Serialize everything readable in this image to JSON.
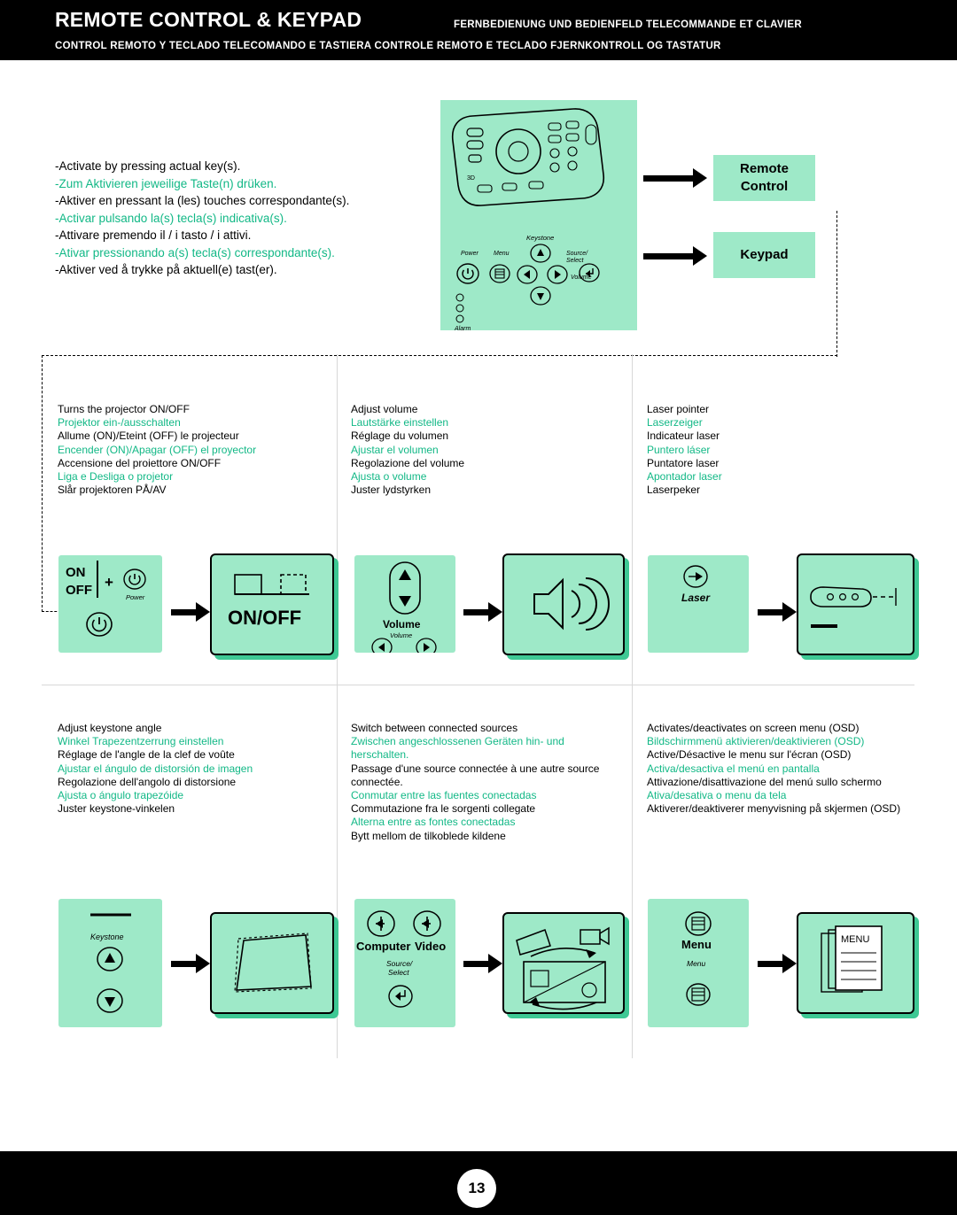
{
  "header": {
    "title": "REMOTE CONTROL & KEYPAD",
    "sub_right": "FERNBEDIENUNG UND BEDIENFELD   TELECOMMANDE ET CLAVIER",
    "sub_bottom": "CONTROL REMOTO Y TECLADO   TELECOMANDO E TASTIERA   CONTROLE REMOTO E TECLADO  FJERNKONTROLL OG TASTATUR"
  },
  "intro": {
    "lines": [
      {
        "text": "-Activate by pressing actual key(s).",
        "green": false
      },
      {
        "text": "-Zum Aktivieren jeweilige Taste(n) drüken.",
        "green": true
      },
      {
        "text": "-Aktiver en pressant la (les) touches correspondante(s).",
        "green": false
      },
      {
        "text": "-Activar pulsando la(s) tecla(s) indicativa(s).",
        "green": true
      },
      {
        "text": "-Attivare premendo il / i tasto / i attivi.",
        "green": false
      },
      {
        "text": "-Ativar pressionando a(s) tecla(s) correspondante(s).",
        "green": true
      },
      {
        "text": "-Aktiver ved å trykke på aktuell(e) tast(er).",
        "green": false
      }
    ]
  },
  "callouts": {
    "remote": "Remote\nControl",
    "remote_line1": "Remote",
    "remote_line2": "Control",
    "keypad": "Keypad"
  },
  "device_labels": {
    "power": "Power",
    "menu": "Menu",
    "keystone": "Keystone",
    "volume": "Volume",
    "source_select": "Source/\nSelect",
    "alarm": "Alarm",
    "on": "ON",
    "off": "OFF",
    "onoff": "ON/OFF",
    "plus": "+",
    "laser": "Laser",
    "computer": "Computer",
    "video": "Video",
    "menu_button": "MENU"
  },
  "cells": [
    {
      "id": "power",
      "lines": [
        {
          "text": "Turns the projector ON/OFF",
          "green": false
        },
        {
          "text": "Projektor ein-/ausschalten",
          "green": true
        },
        {
          "text": "Allume (ON)/Eteint (OFF) le projecteur",
          "green": false
        },
        {
          "text": "Encender (ON)/Apagar (OFF) el proyector",
          "green": true
        },
        {
          "text": "Accensione del proiettore ON/OFF",
          "green": false
        },
        {
          "text": "Liga e Desliga o projetor",
          "green": true
        },
        {
          "text": "Slår projektoren PÅ/AV",
          "green": false
        }
      ]
    },
    {
      "id": "volume",
      "lines": [
        {
          "text": "Adjust volume",
          "green": false
        },
        {
          "text": "Lautstärke einstellen",
          "green": true
        },
        {
          "text": "Réglage du volumen",
          "green": false
        },
        {
          "text": "Ajustar el volumen",
          "green": true
        },
        {
          "text": "Regolazione del volume",
          "green": false
        },
        {
          "text": "Ajusta o volume",
          "green": true
        },
        {
          "text": "Juster lydstyrken",
          "green": false
        }
      ]
    },
    {
      "id": "laser",
      "lines": [
        {
          "text": "Laser pointer",
          "green": false
        },
        {
          "text": "Laserzeiger",
          "green": true
        },
        {
          "text": "Indicateur laser",
          "green": false
        },
        {
          "text": "Puntero láser",
          "green": true
        },
        {
          "text": "Puntatore laser",
          "green": false
        },
        {
          "text": "Apontador laser",
          "green": true
        },
        {
          "text": "Laserpeker",
          "green": false
        }
      ]
    },
    {
      "id": "keystone",
      "lines": [
        {
          "text": "Adjust keystone angle",
          "green": false
        },
        {
          "text": "Winkel Trapezentzerrung einstellen",
          "green": true
        },
        {
          "text": "Réglage de l'angle de la clef de voûte",
          "green": false
        },
        {
          "text": "Ajustar el ángulo de distorsión de imagen",
          "green": true
        },
        {
          "text": "Regolazione dell'angolo di distorsione",
          "green": false
        },
        {
          "text": "Ajusta o ángulo trapezóide",
          "green": true
        },
        {
          "text": "Juster keystone-vinkelen",
          "green": false
        }
      ]
    },
    {
      "id": "source",
      "lines": [
        {
          "text": "Switch between connected sources",
          "green": false
        },
        {
          "text": "Zwischen angeschlossenen Geräten hin- und herschalten.",
          "green": true
        },
        {
          "text": "Passage d'une source connectée à une autre source connectée.",
          "green": false
        },
        {
          "text": "Conmutar entre las fuentes conectadas",
          "green": true
        },
        {
          "text": "Commutazione fra le sorgenti collegate",
          "green": false
        },
        {
          "text": "Alterna entre as fontes conectadas",
          "green": true
        },
        {
          "text": "Bytt mellom de tilkoblede kildene",
          "green": false
        }
      ]
    },
    {
      "id": "menu",
      "lines": [
        {
          "text": "Activates/deactivates on screen menu (OSD)",
          "green": false
        },
        {
          "text": "Bildschirmmenü aktivieren/deaktivieren (OSD)",
          "green": true
        },
        {
          "text": "Active/Désactive le menu sur l'écran (OSD)",
          "green": false
        },
        {
          "text": "Activa/desactiva el  menú en pantalla",
          "green": true
        },
        {
          "text": "Attivazione/disattivazione del menú sullo schermo",
          "green": false
        },
        {
          "text": "Ativa/desativa o menu da tela",
          "green": true
        },
        {
          "text": "Aktiverer/deaktiverer menyvisning på skjermen (OSD)",
          "green": false
        }
      ]
    }
  ],
  "footer": {
    "page": "13"
  },
  "colors": {
    "mint": "#9ee9c8",
    "green_text": "#12b886",
    "shadow": "#3ec894"
  }
}
